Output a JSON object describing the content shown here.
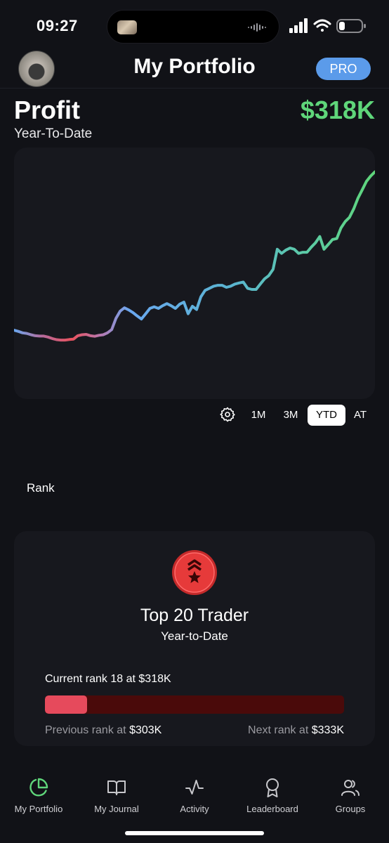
{
  "status_bar": {
    "time": "09:27"
  },
  "header": {
    "title": "My Portfolio",
    "badge": "PRO"
  },
  "profit": {
    "label": "Profit",
    "value": "$318K",
    "period": "Year-To-Date",
    "value_color": "#5fd67a"
  },
  "chart_data": {
    "type": "line",
    "title": "",
    "xlabel": "",
    "ylabel": "",
    "grid": false,
    "legend": "none",
    "gradient_colors": [
      "#e8525e",
      "#6aa8f0",
      "#5fd67a"
    ],
    "series": [
      {
        "values": [
          0.148,
          0.142,
          0.134,
          0.131,
          0.124,
          0.119,
          0.117,
          0.117,
          0.112,
          0.104,
          0.098,
          0.096,
          0.096,
          0.099,
          0.101,
          0.119,
          0.124,
          0.126,
          0.119,
          0.116,
          0.121,
          0.124,
          0.134,
          0.151,
          0.21,
          0.249,
          0.266,
          0.255,
          0.241,
          0.223,
          0.207,
          0.235,
          0.263,
          0.271,
          0.263,
          0.277,
          0.288,
          0.277,
          0.263,
          0.285,
          0.296,
          0.235,
          0.274,
          0.257,
          0.324,
          0.358,
          0.369,
          0.38,
          0.385,
          0.385,
          0.374,
          0.38,
          0.391,
          0.397,
          0.402,
          0.369,
          0.363,
          0.363,
          0.391,
          0.419,
          0.436,
          0.469,
          0.575,
          0.553,
          0.57,
          0.581,
          0.575,
          0.553,
          0.559,
          0.559,
          0.586,
          0.609,
          0.642,
          0.575,
          0.6,
          0.626,
          0.631,
          0.687,
          0.721,
          0.743,
          0.788,
          0.844,
          0.888,
          0.933,
          0.961,
          0.983
        ]
      }
    ],
    "ylim": [
      0,
      1
    ]
  },
  "range": {
    "settings_icon": "gear-icon",
    "options": [
      "1M",
      "3M",
      "YTD",
      "AT"
    ],
    "selected": "YTD"
  },
  "rank": {
    "heading": "Rank",
    "badge_icon": "rank-chevrons-star-icon",
    "badge_color": "#e63a3a",
    "title": "Top 20 Trader",
    "period": "Year-to-Date",
    "current": "Current rank 18 at $318K",
    "progress": 0.14,
    "previous_label": "Previous rank at",
    "previous_amount": "$303K",
    "next_label": "Next rank at",
    "next_amount": "$333K"
  },
  "tabs": [
    {
      "label": "My Portfolio",
      "icon": "pie-chart-icon",
      "active": true
    },
    {
      "label": "My Journal",
      "icon": "book-icon",
      "active": false
    },
    {
      "label": "Activity",
      "icon": "activity-icon",
      "active": false
    },
    {
      "label": "Leaderboard",
      "icon": "award-icon",
      "active": false
    },
    {
      "label": "Groups",
      "icon": "users-icon",
      "active": false
    }
  ],
  "colors": {
    "accent_green": "#5fd67a",
    "pro_blue": "#5b9bea",
    "rank_red": "#e64a5c"
  }
}
